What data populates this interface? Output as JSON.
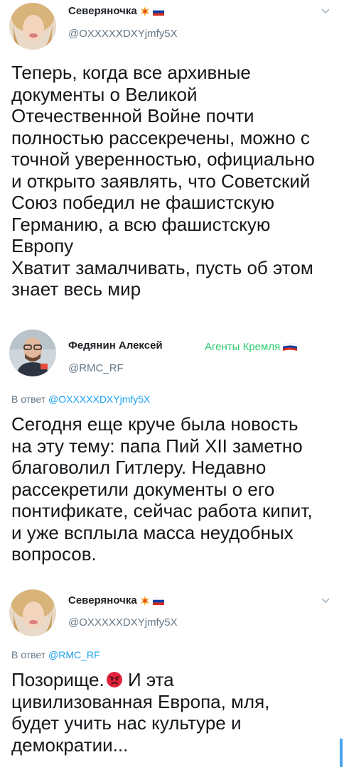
{
  "tweets": [
    {
      "name": "Северяночка",
      "handle": "@OXXXXXDXYjmfy5X",
      "body_lines": [
        "Теперь, когда все архивные",
        "документы о Великой",
        "Отечественной Войне почти",
        "полностью рассекречены, можно с",
        "точной уверенностью, официально",
        "и открыто заявлять, что Советский",
        "Союз победил не фашистскую",
        "Германию, а всю фашистскую",
        "Европу",
        "Хватит замалчивать, пусть об этом",
        "знает весь мир"
      ]
    },
    {
      "name": "Федянин Алексей",
      "handle": "@RMC_RF",
      "tag": "Агенты Кремля",
      "reply_prefix": "В ответ",
      "reply_handle": "@OXXXXXDXYjmfy5X",
      "body_lines": [
        "Сегодня еще круче была новость",
        "на эту тему: папа Пий XII заметно",
        "благоволил Гитлеру. Недавно",
        "рассекретили документы о его",
        "понтификате, сейчас работа кипит,",
        "и уже всплыла масса неудобных",
        "вопросов."
      ]
    },
    {
      "name": "Северяночка",
      "handle": "@OXXXXXDXYjmfy5X",
      "reply_prefix": "В ответ",
      "reply_handle": "@RMC_RF",
      "body_line1_a": "Позорище.",
      "body_line1_b": " И эта",
      "body_lines": [
        "цивилизованная Европа, мля,",
        "будет учить нас культуре и",
        "демократии..."
      ]
    }
  ],
  "icons": [
    "chevron-down-icon",
    "explosion-emoji-icon",
    "russian-flag-icon",
    "angry-face-emoji-icon"
  ],
  "colors": {
    "handle": "#657786",
    "link": "#1da1f2",
    "tag": "#2ecc71",
    "flag_white": "#ffffff",
    "flag_blue": "#0039a6",
    "flag_red": "#d52b1e"
  }
}
